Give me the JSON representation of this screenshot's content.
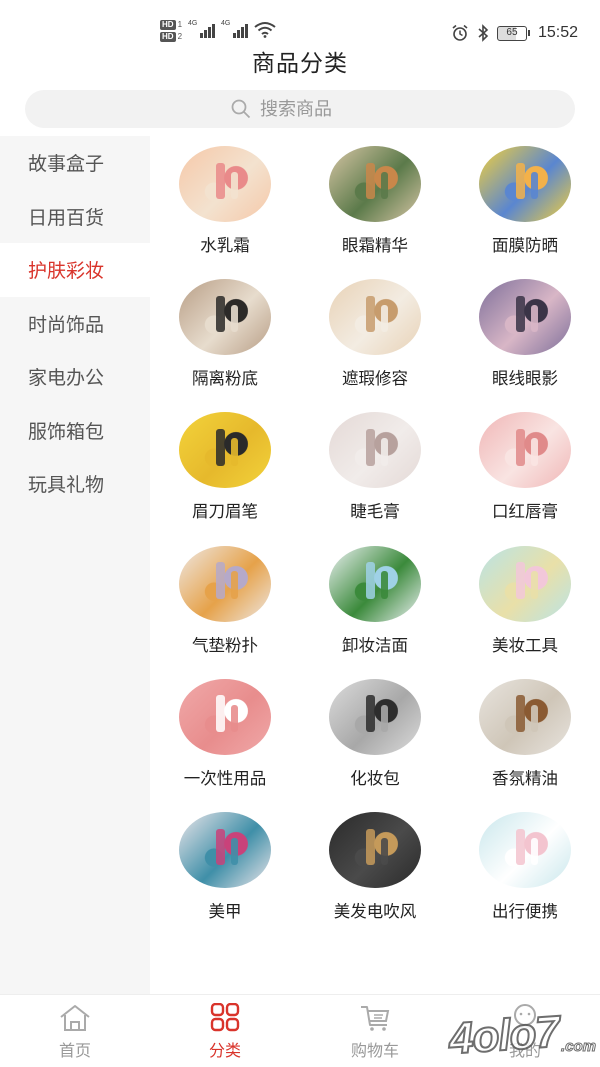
{
  "status_bar": {
    "hd1": "HD",
    "hd1_num": "1",
    "hd2": "HD",
    "hd2_num": "2",
    "net1": "4G",
    "net2": "4G",
    "battery": "65",
    "time": "15:52"
  },
  "header": {
    "title": "商品分类",
    "search_placeholder": "搜索商品"
  },
  "sidebar": {
    "items": [
      {
        "label": "故事盒子"
      },
      {
        "label": "日用百货"
      },
      {
        "label": "护肤彩妆",
        "active": true
      },
      {
        "label": "时尚饰品"
      },
      {
        "label": "家电办公"
      },
      {
        "label": "服饰箱包"
      },
      {
        "label": "玩具礼物"
      }
    ]
  },
  "categories": [
    {
      "label": "水乳霜",
      "icon": "skincare-bottles-photo",
      "colors": [
        "#f6c8a8",
        "#e98a8a",
        "#f3e2cf"
      ]
    },
    {
      "label": "眼霜精华",
      "icon": "serum-dropper-photo",
      "colors": [
        "#d8c6a6",
        "#c9874a",
        "#5b7a4a"
      ]
    },
    {
      "label": "面膜防晒",
      "icon": "sunscreen-tube-photo",
      "colors": [
        "#f4d13a",
        "#f3b14a",
        "#5a86d0"
      ]
    },
    {
      "label": "隔离粉底",
      "icon": "foundation-compact-photo",
      "colors": [
        "#b89e86",
        "#2c2a28",
        "#e7dccd"
      ]
    },
    {
      "label": "遮瑕修容",
      "icon": "concealer-stick-photo",
      "colors": [
        "#e8d2b6",
        "#c79c6d",
        "#f3ece2"
      ]
    },
    {
      "label": "眼线眼影",
      "icon": "eyeshadow-palette-photo",
      "colors": [
        "#7d6f9a",
        "#3a3447",
        "#d8b6c6"
      ]
    },
    {
      "label": "眉刀眉笔",
      "icon": "eyebrow-pencil-photo",
      "colors": [
        "#f3d33b",
        "#2a2a2a",
        "#e6b92c"
      ]
    },
    {
      "label": "睫毛膏",
      "icon": "mascara-photo",
      "colors": [
        "#e4d9d6",
        "#b7a19d",
        "#f1ecea"
      ]
    },
    {
      "label": "口红唇膏",
      "icon": "lipstick-photo",
      "colors": [
        "#f0b6b6",
        "#e08a8a",
        "#f9e4e2"
      ]
    },
    {
      "label": "气垫粉扑",
      "icon": "makeup-sponge-photo",
      "colors": [
        "#eee8e4",
        "#b5a9c9",
        "#e6a24a"
      ]
    },
    {
      "label": "卸妆洁面",
      "icon": "cleanser-pouch-photo",
      "colors": [
        "#eef2f5",
        "#9fd1e6",
        "#3b8a3b"
      ]
    },
    {
      "label": "美妆工具",
      "icon": "eyelash-curler-photo",
      "colors": [
        "#b9e3e6",
        "#f2c7d9",
        "#e9e0a8"
      ]
    },
    {
      "label": "一次性用品",
      "icon": "tissue-box-photo",
      "colors": [
        "#f0a9a9",
        "#ffffff",
        "#e88d8d"
      ]
    },
    {
      "label": "化妆包",
      "icon": "cosmetic-bag-photo",
      "colors": [
        "#dcdcdc",
        "#2d2d2d",
        "#a8a8a8"
      ]
    },
    {
      "label": "香氛精油",
      "icon": "essential-oil-photo",
      "colors": [
        "#e8e4de",
        "#8a5a32",
        "#cfc6b8"
      ]
    },
    {
      "label": "美甲",
      "icon": "nail-polish-photo",
      "colors": [
        "#ece6ea",
        "#c9427a",
        "#3f8fa8"
      ]
    },
    {
      "label": "美发电吹风",
      "icon": "hair-tools-photo",
      "colors": [
        "#2a2a2a",
        "#c59a5a",
        "#4a4a4a"
      ]
    },
    {
      "label": "出行便携",
      "icon": "travel-bottles-photo",
      "colors": [
        "#c9e7ec",
        "#f3c4cf",
        "#ffffff"
      ]
    }
  ],
  "tabbar": {
    "items": [
      {
        "label": "首页",
        "icon": "home-icon"
      },
      {
        "label": "分类",
        "icon": "category-grid-icon",
        "active": true
      },
      {
        "label": "购物车",
        "icon": "cart-icon"
      },
      {
        "label": "我的",
        "icon": "profile-icon"
      }
    ],
    "active_color": "#d9342b"
  },
  "watermark": {
    "text": "4olo7",
    "domain": ".com"
  }
}
